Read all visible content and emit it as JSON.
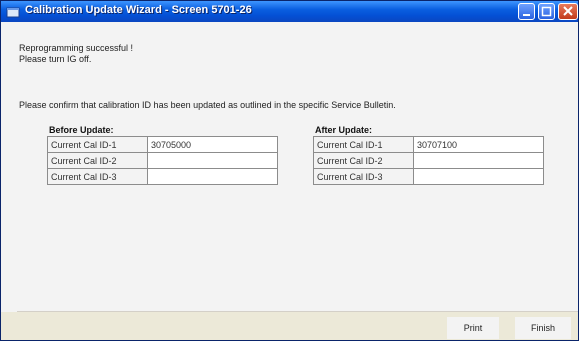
{
  "window": {
    "title": "Calibration Update Wizard - Screen 5701-26",
    "icon": "wrench-window-icon"
  },
  "messages": {
    "line1": "Reprogramming successful !",
    "line2": "Please turn IG off.",
    "confirm": "Please confirm that calibration ID has been updated as outlined in the specific Service Bulletin."
  },
  "before": {
    "title": "Before Update:",
    "rows": [
      {
        "label": "Current Cal ID-1",
        "value": "30705000"
      },
      {
        "label": "Current Cal ID-2",
        "value": ""
      },
      {
        "label": "Current Cal ID-3",
        "value": ""
      }
    ]
  },
  "after": {
    "title": "After Update:",
    "rows": [
      {
        "label": "Current Cal ID-1",
        "value": "30707100"
      },
      {
        "label": "Current Cal ID-2",
        "value": ""
      },
      {
        "label": "Current Cal ID-3",
        "value": ""
      }
    ]
  },
  "buttons": {
    "print": "Print",
    "finish": "Finish"
  },
  "colors": {
    "titlebar": "#0A5FE0",
    "background": "#F3F3F3"
  }
}
